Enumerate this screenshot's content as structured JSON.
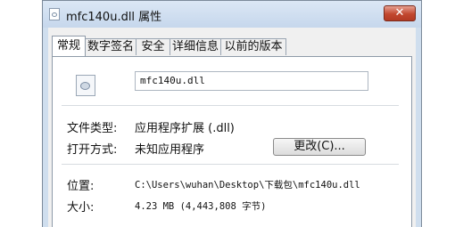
{
  "window": {
    "title": "mfc140u.dll 属性",
    "close_glyph": "✕"
  },
  "tabs": [
    "常规",
    "数字签名",
    "安全",
    "详细信息",
    "以前的版本"
  ],
  "file_name": "mfc140u.dll",
  "rows": {
    "file_type": {
      "label": "文件类型:",
      "value": "应用程序扩展 (.dll)"
    },
    "opens_with": {
      "label": "打开方式:",
      "value": "未知应用程序"
    },
    "location": {
      "label": "位置:",
      "value": "C:\\Users\\wuhan\\Desktop\\下载包\\mfc140u.dll"
    },
    "size": {
      "label": "大小:",
      "value": "4.23 MB (4,443,808 字节)"
    }
  },
  "change_button": "更改(C)..."
}
